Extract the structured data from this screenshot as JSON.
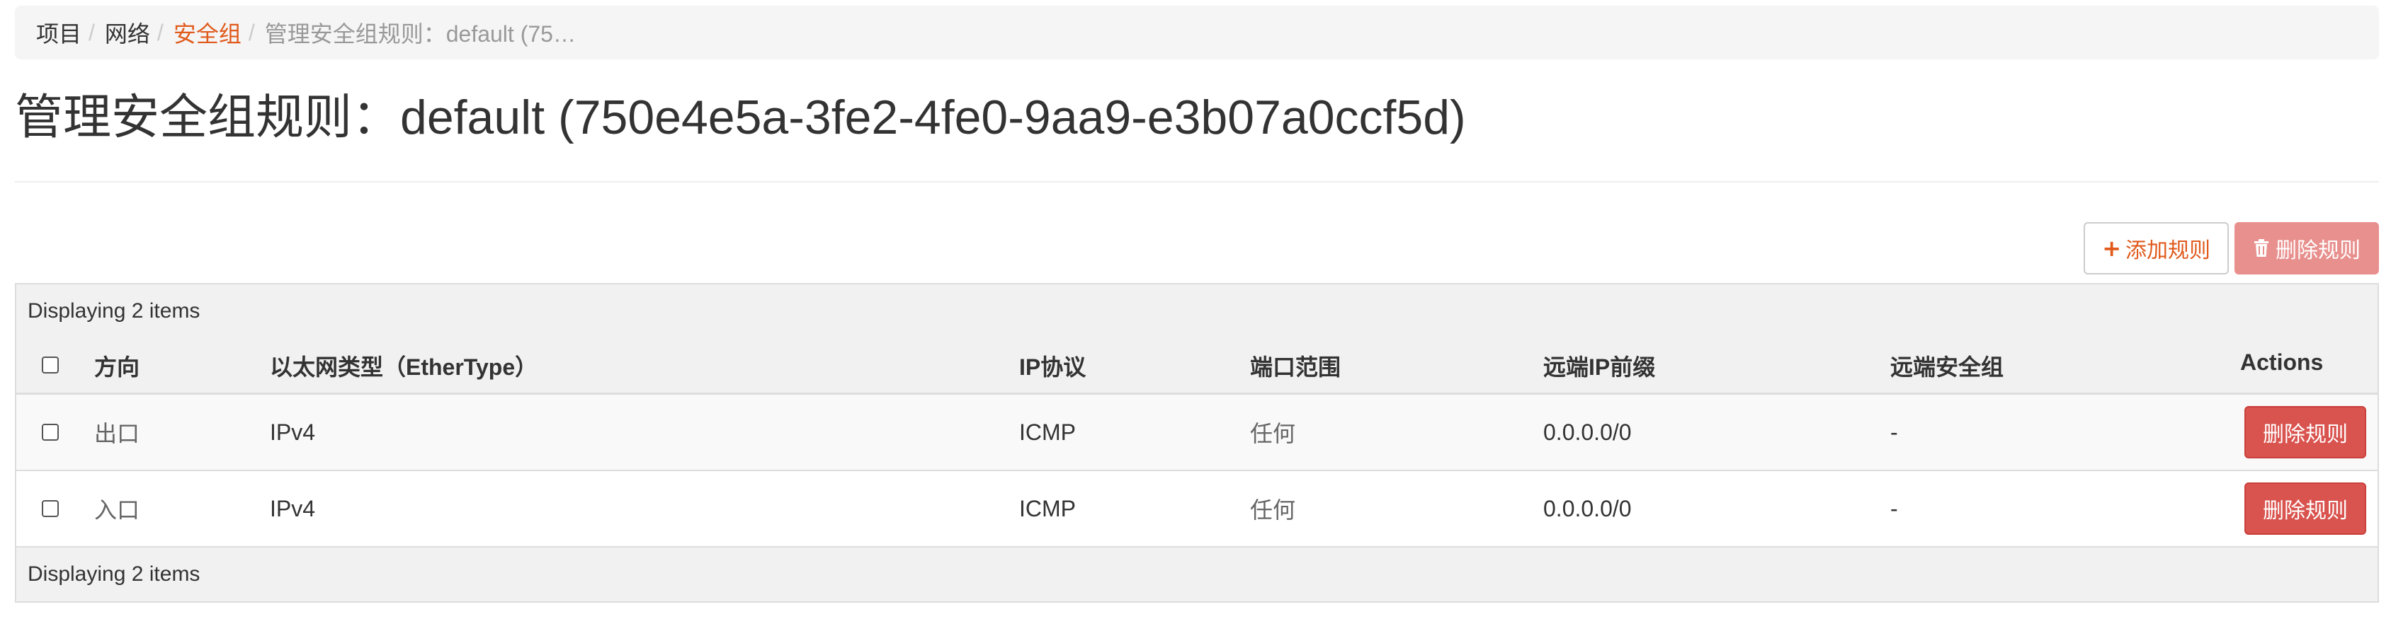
{
  "breadcrumb": {
    "items": [
      {
        "label": "项目",
        "type": "text"
      },
      {
        "label": "网络",
        "type": "text"
      },
      {
        "label": "安全组",
        "type": "link"
      },
      {
        "label": "管理安全组规则：default (75…",
        "type": "active"
      }
    ],
    "separator": "/"
  },
  "page": {
    "title": "管理安全组规则：default (750e4e5a-3fe2-4fe0-9aa9-e3b07a0ccf5d)"
  },
  "toolbar": {
    "add_rule": {
      "icon": "plus-icon",
      "glyph": "+",
      "label": "添加规则"
    },
    "delete_rules": {
      "icon": "trash-icon",
      "glyph": "🗑",
      "label": "删除规则",
      "disabled": true
    }
  },
  "table": {
    "caption": "Displaying 2 items",
    "footer": "Displaying 2 items",
    "columns": {
      "direction": "方向",
      "ethertype": "以太网类型（EtherType）",
      "ip_protocol": "IP协议",
      "port_range": "端口范围",
      "remote_ip_prefix": "远端IP前缀",
      "remote_security_group": "远端安全组",
      "actions": "Actions"
    },
    "rows": [
      {
        "direction": "出口",
        "ethertype": "IPv4",
        "ip_protocol": "ICMP",
        "port_range": "任何",
        "remote_ip_prefix": "0.0.0.0/0",
        "remote_security_group": "-",
        "action_label": "删除规则"
      },
      {
        "direction": "入口",
        "ethertype": "IPv4",
        "ip_protocol": "ICMP",
        "port_range": "任何",
        "remote_ip_prefix": "0.0.0.0/0",
        "remote_security_group": "-",
        "action_label": "删除规则"
      }
    ]
  },
  "colors": {
    "accent": "#e05a1c",
    "danger": "#d9534f",
    "danger_disabled": "#e8908e"
  }
}
